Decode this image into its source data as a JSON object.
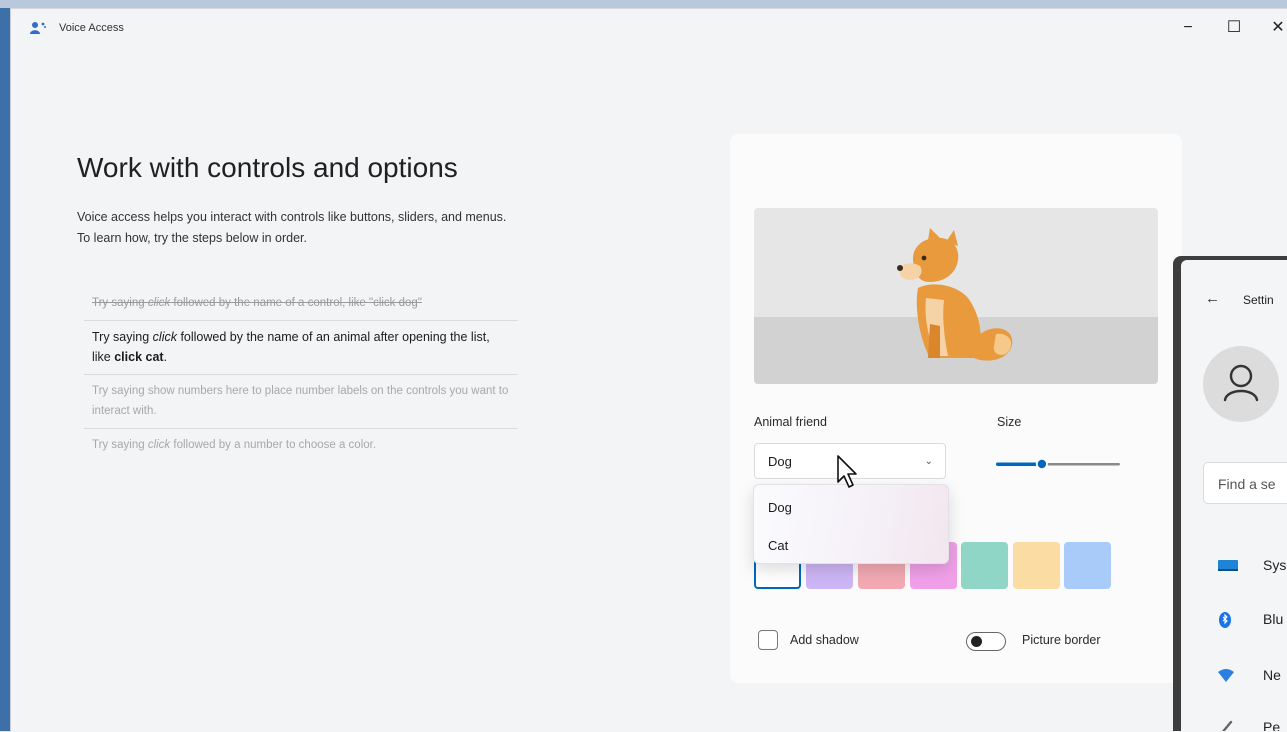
{
  "window": {
    "title": "Voice Access",
    "controls": {
      "minimize": "−",
      "maximize": "☐",
      "close": "✕"
    }
  },
  "main": {
    "heading": "Work with controls and options",
    "description": "Voice access helps you interact with controls like buttons, sliders, and menus. To learn how, try the steps below in order.",
    "steps": [
      {
        "status": "completed",
        "parts": [
          "Try saying ",
          "click",
          " followed by the name of a control, like \"click dog\""
        ]
      },
      {
        "status": "current",
        "parts": [
          "Try saying ",
          "click",
          " followed by the name of an animal after opening the list, like ",
          "click cat",
          "."
        ]
      },
      {
        "status": "upcoming",
        "parts": [
          "Try saying ",
          "show numbers here",
          " to place number labels on the controls you want to interact with."
        ]
      },
      {
        "status": "upcoming",
        "parts": [
          "Try saying ",
          "click",
          " followed by a number to choose a color."
        ]
      }
    ]
  },
  "panel": {
    "animal_label": "Animal friend",
    "size_label": "Size",
    "animal_select": {
      "value": "Dog",
      "options": [
        "Dog",
        "Cat"
      ]
    },
    "size_slider_value": 0.37,
    "swatch_colors": [
      "#ffffff",
      "#cdb6f5",
      "#f3a9b2",
      "#f0a0e8",
      "#8fd6c6",
      "#fbdca3",
      "#a9cbfa"
    ],
    "add_shadow": {
      "label": "Add shadow",
      "checked": false
    },
    "picture_border": {
      "label": "Picture border",
      "on": false
    }
  },
  "settings_window": {
    "title": "Settin",
    "search_placeholder": "Find a se",
    "items": [
      {
        "label": "Sys",
        "icon": "system-display-icon",
        "color": "#1f84d6"
      },
      {
        "label": "Blu",
        "icon": "bluetooth-icon",
        "color": "#1a73e8"
      },
      {
        "label": "Ne",
        "icon": "wifi-icon",
        "color": "#2b7fe0"
      },
      {
        "label": "Pe",
        "icon": "brush-icon",
        "color": "#666666"
      }
    ]
  },
  "colors": {
    "accent": "#0067c0"
  }
}
